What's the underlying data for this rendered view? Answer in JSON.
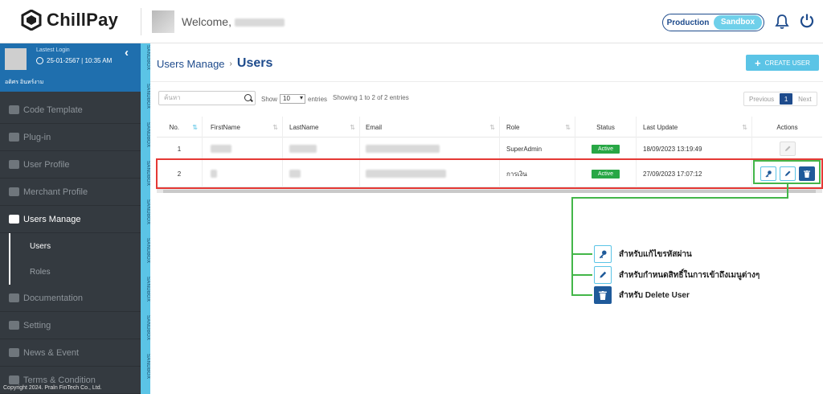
{
  "header": {
    "logo_text": "ChillPay",
    "welcome_label": "Welcome,",
    "env_production": "Production",
    "env_sandbox": "Sandbox"
  },
  "sidebar": {
    "last_login_label": "Lastest Login",
    "last_login_value": "25-01-2567 | 10:35 AM",
    "user_name": "อดิศร อินทร์งาม",
    "items": [
      {
        "label": "Code Template",
        "icon": "file-code-icon"
      },
      {
        "label": "Plug-in",
        "icon": "plug-icon"
      },
      {
        "label": "User Profile",
        "icon": "user-icon"
      },
      {
        "label": "Merchant Profile",
        "icon": "users-icon"
      },
      {
        "label": "Users Manage",
        "icon": "user-cog-icon"
      },
      {
        "label": "Documentation",
        "icon": "folder-icon"
      },
      {
        "label": "Setting",
        "icon": "cogs-icon"
      },
      {
        "label": "News & Event",
        "icon": "news-icon"
      },
      {
        "label": "Terms & Condition",
        "icon": "asterisk-icon"
      }
    ],
    "sub_items": [
      {
        "label": "Users"
      },
      {
        "label": "Roles"
      }
    ],
    "copyright": "Copyright 2024. Praln FinTech Co., Ltd.",
    "sandbox_strip": "SANDBOX"
  },
  "page": {
    "breadcrumb_parent": "Users Manage",
    "breadcrumb_sep": "›",
    "title": "Users",
    "create_button": "CREATE USER"
  },
  "table_controls": {
    "search_placeholder": "ค้นหา",
    "show_label": "Show",
    "entries_value": "10",
    "entries_label": "entries",
    "info": "Showing 1 to 2 of 2 entries",
    "pager": {
      "prev": "Previous",
      "current": "1",
      "next": "Next"
    }
  },
  "table": {
    "columns": [
      "No.",
      "FirstName",
      "LastName",
      "Email",
      "Role",
      "Status",
      "Last Update",
      "Actions"
    ],
    "rows": [
      {
        "no": "1",
        "role": "SuperAdmin",
        "status": "Active",
        "last_update": "18/09/2023 13:19:49"
      },
      {
        "no": "2",
        "role": "การเงิน",
        "status": "Active",
        "last_update": "27/09/2023 17:07:12"
      }
    ]
  },
  "legend": {
    "reset_password": "สำหรับแก้ไขรหัสผ่าน",
    "edit_permission": "สำหรับกำหนดสิทธิ์ในการเข้าถึงเมนูต่างๆ",
    "delete_user": "สำหรับ Delete User"
  },
  "colors": {
    "primary": "#1e4b8c",
    "accent": "#5bc4e6",
    "sidebar_bg": "#343a40",
    "active_badge": "#28a745",
    "highlight_red": "#e53935",
    "highlight_green": "#43b649"
  }
}
